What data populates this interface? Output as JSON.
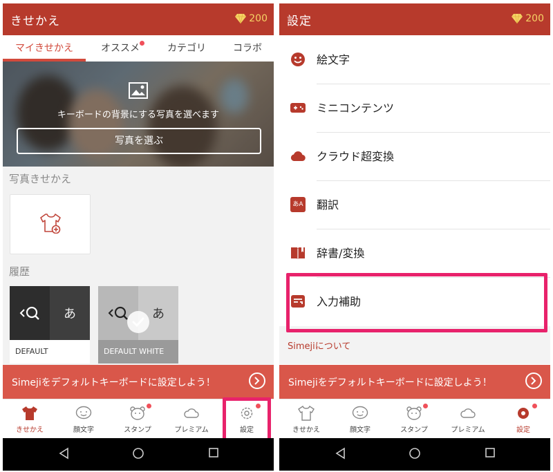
{
  "left": {
    "appbar": {
      "title": "きせかえ",
      "gems": "200"
    },
    "tabs": [
      "マイきせかえ",
      "オススメ",
      "カテゴリ",
      "コラボ"
    ],
    "banner": {
      "caption": "キーボードの背景にする写真を選べます",
      "button": "写真を選ぶ"
    },
    "photo_section_title": "写真きせかえ",
    "history_title": "履歴",
    "keyboards": [
      {
        "label": "DEFAULT",
        "left_glyph": "<Q",
        "right_glyph": "あ"
      },
      {
        "label": "DEFAULT WHITE",
        "left_glyph": "<Q",
        "right_glyph": "あ"
      }
    ],
    "cta": "Simejiをデフォルトキーボードに設定しよう！",
    "nav": [
      "きせかえ",
      "顔文字",
      "スタンプ",
      "プレミアム",
      "設定"
    ]
  },
  "right": {
    "appbar": {
      "title": "設定",
      "gems": "200"
    },
    "menu": [
      "絵文字",
      "ミニコンテンツ",
      "クラウド超変換",
      "翻訳",
      "辞書/変換",
      "入力補助"
    ],
    "translate_icon_text": "あA",
    "about": "Simejiについて",
    "cta": "Simejiをデフォルトキーボードに設定しよう！",
    "nav": [
      "きせかえ",
      "顔文字",
      "スタンプ",
      "プレミアム",
      "設定"
    ]
  },
  "colors": {
    "brand": "#b73a2c",
    "cta": "#d9574a",
    "highlight": "#e8226b",
    "gem": "#f6d365"
  }
}
